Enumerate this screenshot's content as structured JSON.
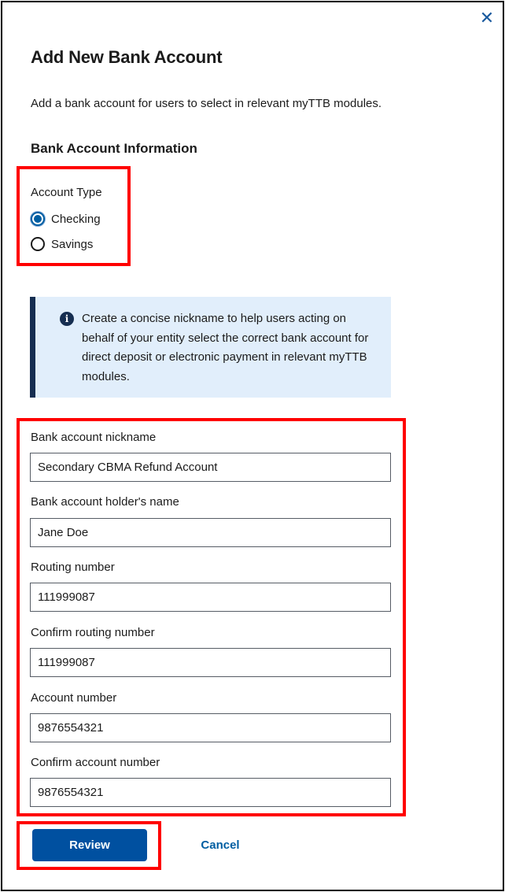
{
  "dialog": {
    "close_icon": "close-icon",
    "title": "Add New Bank Account",
    "intro": "Add a bank account for users to select in relevant myTTB modules.",
    "section_heading": "Bank Account Information"
  },
  "account_type": {
    "legend": "Account Type",
    "options": [
      {
        "label": "Checking",
        "checked": true
      },
      {
        "label": "Savings",
        "checked": false
      }
    ]
  },
  "info_alert": {
    "icon": "info-icon",
    "icon_glyph": "i",
    "text": "Create a concise nickname to help users acting on behalf of your entity select the correct bank account for direct deposit or electronic payment in relevant myTTB modules."
  },
  "fields": [
    {
      "label": "Bank account nickname",
      "value": "Secondary CBMA Refund Account"
    },
    {
      "label": "Bank account holder's name",
      "value": "Jane Doe"
    },
    {
      "label": "Routing number",
      "value": "111999087"
    },
    {
      "label": "Confirm routing number",
      "value": "111999087"
    },
    {
      "label": "Account number",
      "value": "9876554321"
    },
    {
      "label": "Confirm account number",
      "value": "9876554321"
    }
  ],
  "actions": {
    "review_label": "Review",
    "cancel_label": "Cancel"
  },
  "colors": {
    "primary": "#0050a0",
    "link": "#005ea2",
    "alert_bg": "#e1eefb",
    "alert_border": "#162e51",
    "highlight": "#ff0000"
  }
}
